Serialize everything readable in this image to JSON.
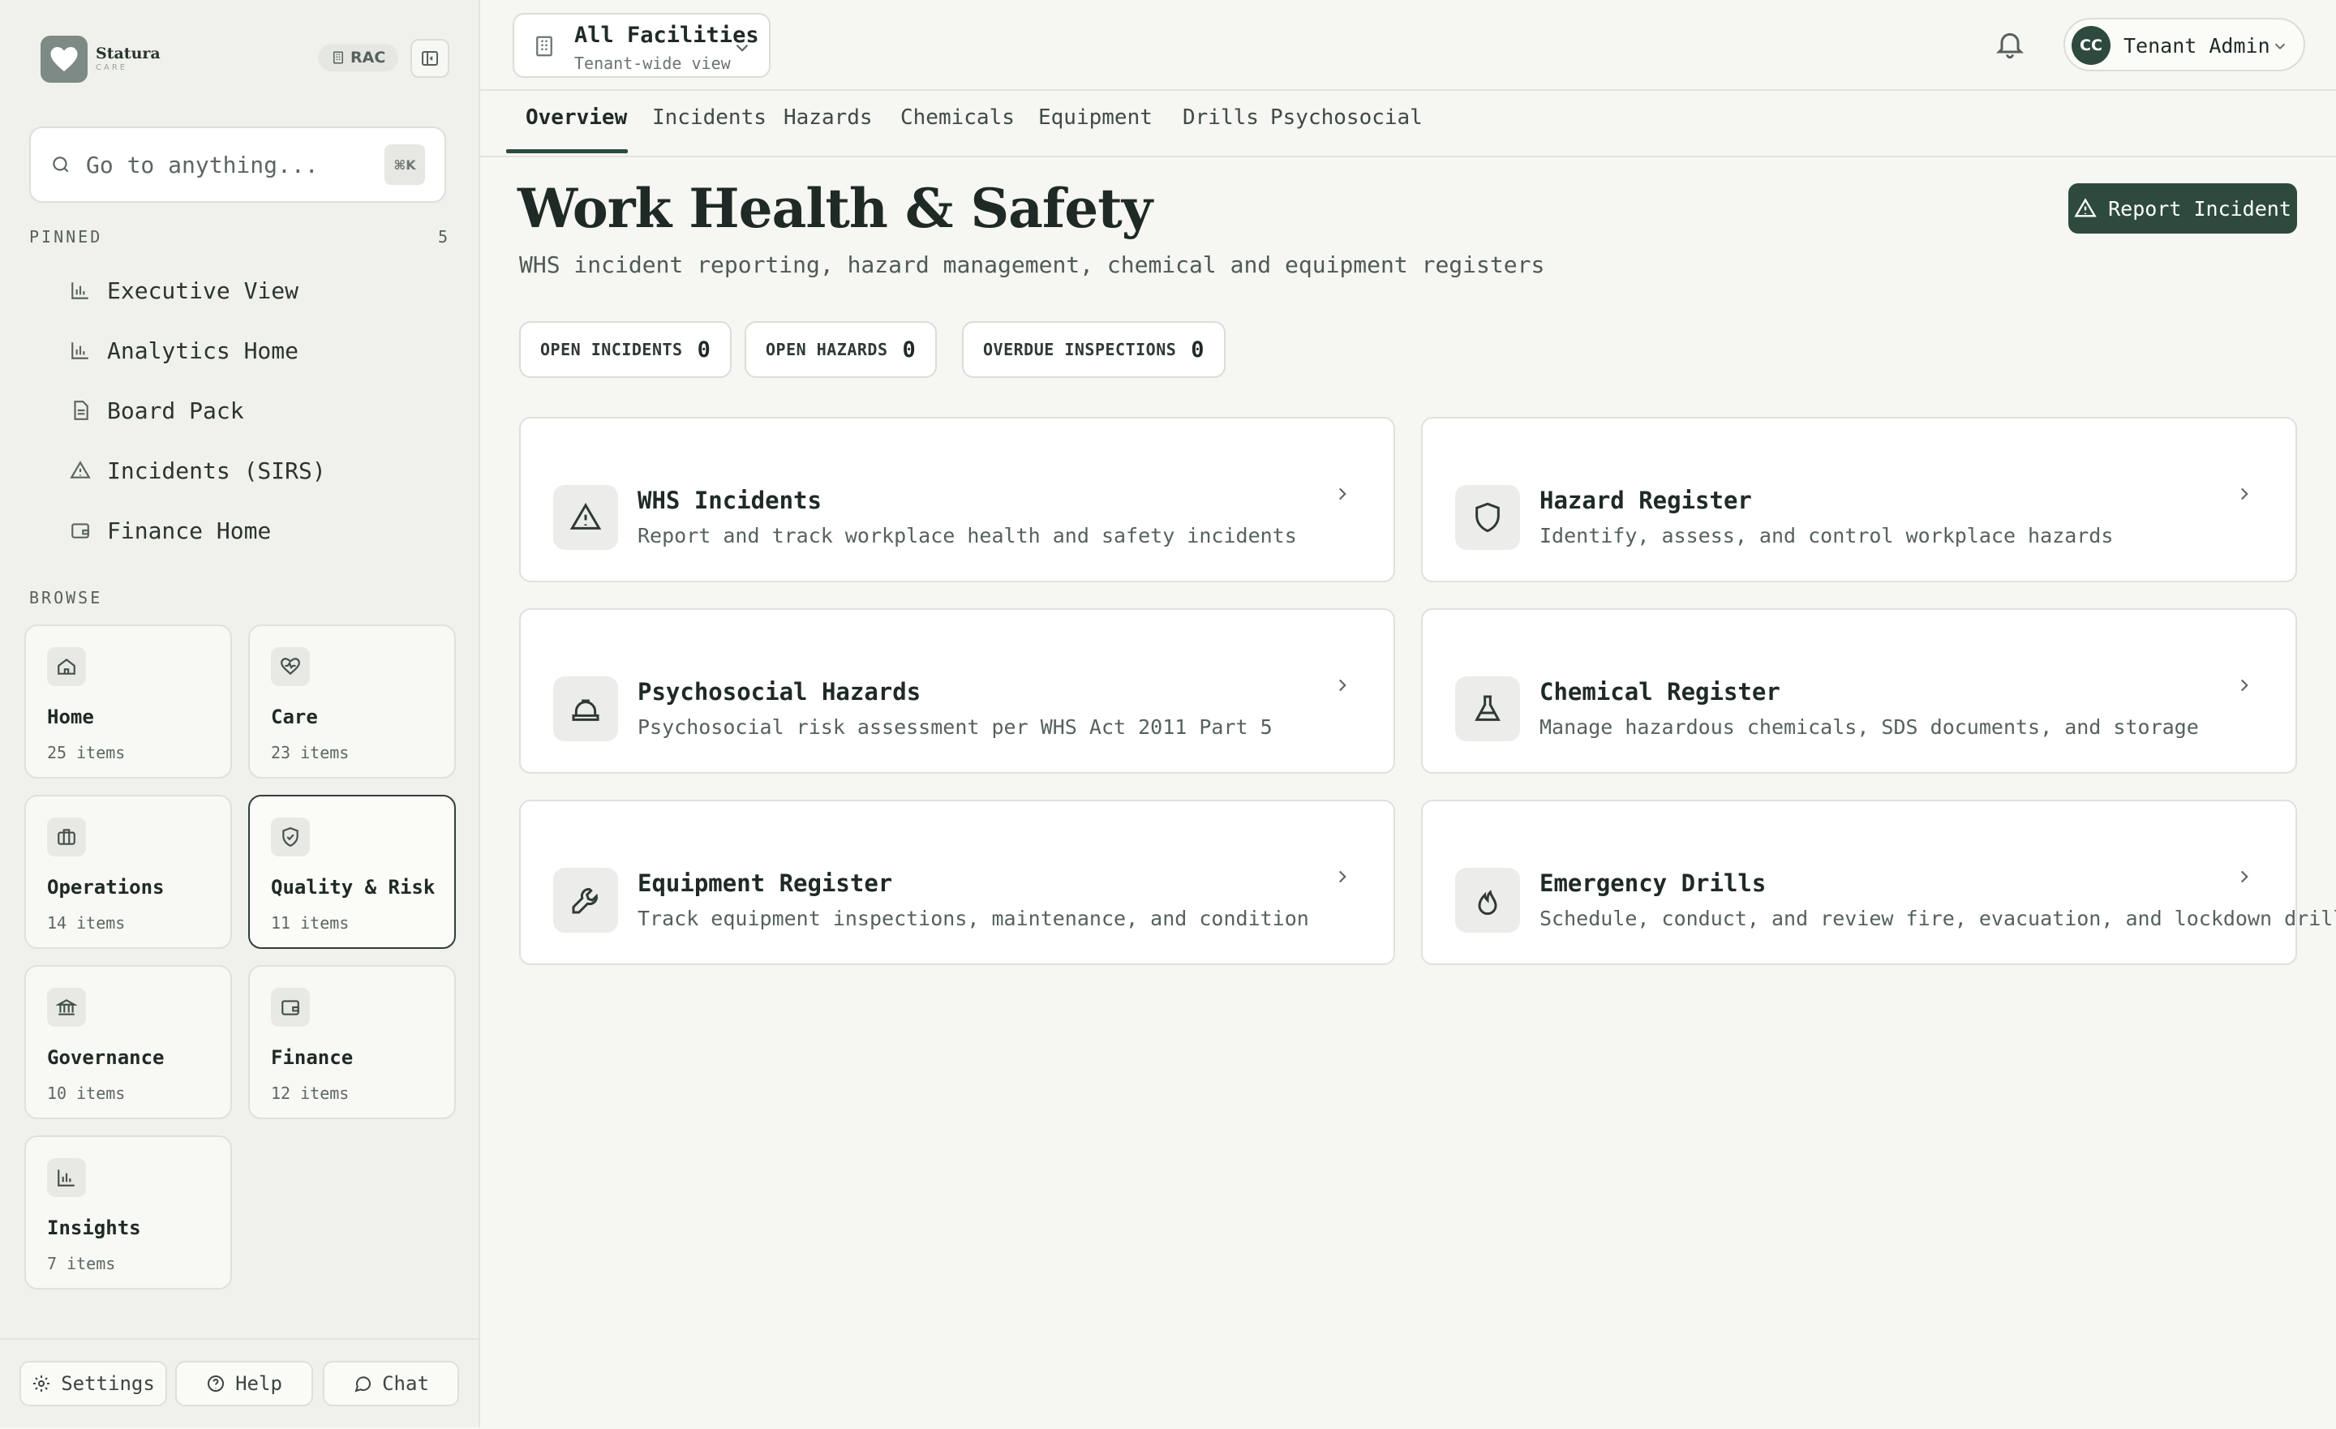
{
  "brand": {
    "name": "Statura",
    "sub": "CARE",
    "org_badge": "RAC"
  },
  "search": {
    "placeholder": "Go to anything...",
    "shortcut": "⌘K"
  },
  "pinned": {
    "label": "PINNED",
    "count": "5",
    "items": [
      {
        "label": "Executive View",
        "icon": "bar-chart-icon"
      },
      {
        "label": "Analytics Home",
        "icon": "bar-chart-icon"
      },
      {
        "label": "Board Pack",
        "icon": "document-icon"
      },
      {
        "label": "Incidents (SIRS)",
        "icon": "warning-icon"
      },
      {
        "label": "Finance Home",
        "icon": "wallet-icon"
      }
    ]
  },
  "browse": {
    "label": "BROWSE",
    "tiles": [
      {
        "title": "Home",
        "count": "25 items",
        "icon": "home-icon"
      },
      {
        "title": "Care",
        "count": "23 items",
        "icon": "heart-icon"
      },
      {
        "title": "Operations",
        "count": "14 items",
        "icon": "briefcase-icon"
      },
      {
        "title": "Quality & Risk",
        "count": "11 items",
        "icon": "shield-check-icon",
        "active": true
      },
      {
        "title": "Governance",
        "count": "10 items",
        "icon": "bank-icon"
      },
      {
        "title": "Finance",
        "count": "12 items",
        "icon": "wallet-icon"
      },
      {
        "title": "Insights",
        "count": "7 items",
        "icon": "bar-chart-icon"
      }
    ]
  },
  "footer": {
    "settings": "Settings",
    "help": "Help",
    "chat": "Chat"
  },
  "facility": {
    "title": "All Facilities",
    "subtitle": "Tenant-wide view"
  },
  "user": {
    "initials": "CC",
    "name": "Tenant Admin"
  },
  "tabs": [
    "Overview",
    "Incidents",
    "Hazards",
    "Chemicals",
    "Equipment",
    "Drills",
    "Psychosocial"
  ],
  "page": {
    "title": "Work Health & Safety",
    "subtitle": "WHS incident reporting, hazard management, chemical and equipment registers",
    "report_button": "Report Incident"
  },
  "stats": [
    {
      "label": "OPEN INCIDENTS",
      "value": "0"
    },
    {
      "label": "OPEN HAZARDS",
      "value": "0"
    },
    {
      "label": "OVERDUE INSPECTIONS",
      "value": "0"
    }
  ],
  "cards": [
    {
      "title": "WHS Incidents",
      "desc": "Report and track workplace health and safety incidents",
      "icon": "warning-icon"
    },
    {
      "title": "Hazard Register",
      "desc": "Identify, assess, and control workplace hazards",
      "icon": "shield-icon"
    },
    {
      "title": "Psychosocial Hazards",
      "desc": "Psychosocial risk assessment per WHS Act 2011 Part 5",
      "icon": "hard-hat-icon"
    },
    {
      "title": "Chemical Register",
      "desc": "Manage hazardous chemicals, SDS documents, and storage",
      "icon": "flask-icon"
    },
    {
      "title": "Equipment Register",
      "desc": "Track equipment inspections, maintenance, and condition",
      "icon": "wrench-icon"
    },
    {
      "title": "Emergency Drills",
      "desc": "Schedule, conduct, and review fire, evacuation, and lockdown drills",
      "icon": "flame-icon"
    }
  ],
  "colors": {
    "accent": "#2e4a3e",
    "background": "#f6f6f2",
    "sidebar": "#f1f1ec"
  }
}
